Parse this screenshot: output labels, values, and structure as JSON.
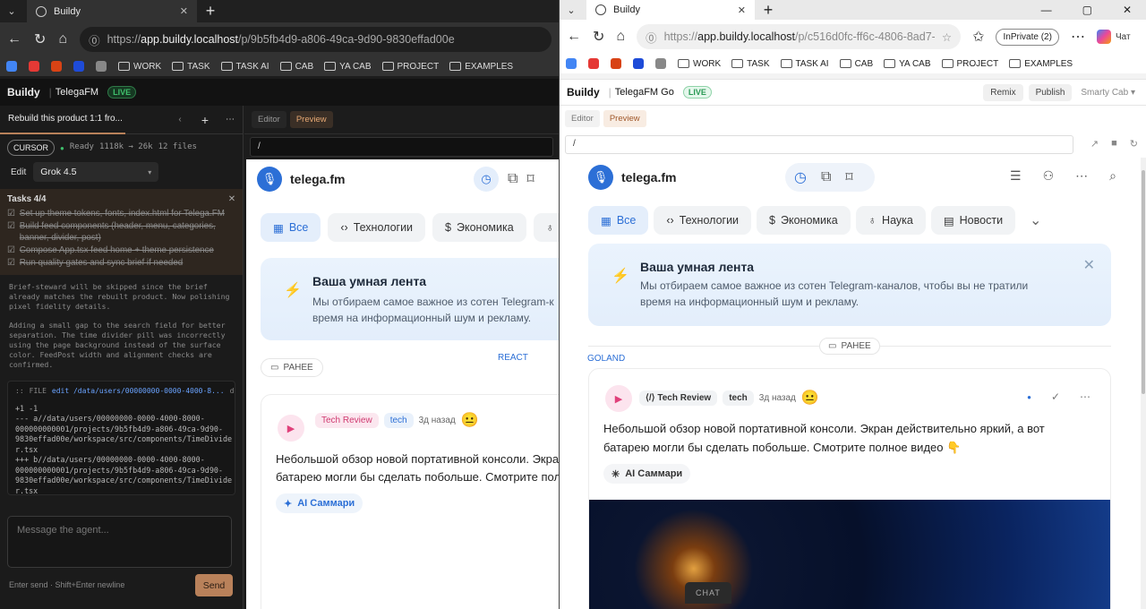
{
  "left": {
    "tab_title": "Buildy",
    "url": {
      "prefix": "https://",
      "host": "app.buildy.localhost",
      "path": "/p/9b5fb4d9-a806-49ca-9d90-9830effad00e"
    },
    "bookmarks": [
      "WORK",
      "TASK",
      "TASK AI",
      "CAB",
      "YA CAB",
      "PROJECT",
      "EXAMPLES"
    ],
    "brand": "Buildy",
    "project": "TelegaFM",
    "live": "LIVE",
    "agent_tab": "Rebuild this product 1:1 fro...",
    "cursor": "CURSOR",
    "ready": "Ready",
    "tokens": "1118k → 26k",
    "files": "12 files",
    "edit_label": "Edit",
    "model": "Grok 4.5",
    "tasks_title": "Tasks 4/4",
    "tasks": [
      "Set up theme tokens, fonts, index.html for Telega.FM",
      "Build feed components (header, menu, categories, banner, divider, post)",
      "Compose App.tsx feed home + theme persistence",
      "Run quality gates and sync brief if needed"
    ],
    "msg1": "Brief-steward will be skipped since the brief already matches the rebuilt product. Now polishing pixel fidelity details.",
    "msg2": "Adding a small gap to the search field for better separation. The time divider pill was incorrectly using the page background instead of the surface color. FeedPost width and alignment checks are confirmed.",
    "file_label": "FILE",
    "file_path": "edit /data/users/00000000-0000-4000-8...",
    "file_status": "done",
    "diff": [
      "+1 -1",
      "--- a//data/users/00000000-0000-4000-8000-",
      "000000000001/projects/9b5fb4d9-a806-49ca-9d90-",
      "9830effad00e/workspace/src/components/TimeDivide",
      "r.tsx",
      "+++ b//data/users/00000000-0000-4000-8000-",
      "000000000001/projects/9b5fb4d9-a806-49ca-9d90-",
      "9830effad00e/workspace/src/components/TimeDivide",
      "r.tsx"
    ],
    "msg_placeholder": "Message the agent...",
    "hint": "Enter send · Shift+Enter newline",
    "send": "Send",
    "editor_tab": "Editor",
    "preview_tab": "Preview",
    "route": "/"
  },
  "right": {
    "tab_title": "Buildy",
    "url": {
      "prefix": "https://",
      "host": "app.buildy.localhost",
      "path": "/p/c516d0fc-ff6c-4806-8ad7-3..."
    },
    "inprivate": "InPrivate (2)",
    "chat": "Чат",
    "brand": "Buildy",
    "project": "TelegaFM Go",
    "live": "LIVE",
    "remix": "Remix",
    "publish": "Publish",
    "smarty": "Smarty Cab",
    "editor_tab": "Editor",
    "preview_tab": "Preview",
    "route": "/",
    "chat_float": "CHAT"
  },
  "app": {
    "logo": "telega.fm",
    "categories": [
      "Все",
      "Технологии",
      "Экономика",
      "Наука",
      "Новости"
    ],
    "categories_left": [
      "Все",
      "Технологии",
      "Экономика",
      "Нау"
    ],
    "banner_title": "Ваша умная лента",
    "banner_text": "Мы отбираем самое важное из сотен Telegram-каналов, чтобы вы не тратили время на информационный шум и рекламу.",
    "banner_text_l1": "Мы отбираем самое важное из сотен Telegram-к",
    "banner_text_l2": "время на информационный шум и рекламу.",
    "divider": "РАНЕЕ",
    "channel_left": "REACT",
    "channel_right": "GOLAND",
    "post_source": "Tech Review",
    "post_tag": "tech",
    "post_time": "3д назад",
    "post_text": "Небольшой обзор новой портативной консоли. Экран действительно яркий, а вот батарею могли бы сделать побольше. Смотрите полное видео 👇",
    "post_l1": "Небольшой обзор новой портативной консоли. Экран",
    "post_l2": "батарею могли бы сделать побольше. Смотрите полн",
    "ai_summary": "AI Саммари"
  },
  "colors": {
    "accent": "#2c6fd6",
    "live": "#3fbe6b",
    "send": "#b9815a",
    "video": "#e0407a"
  }
}
